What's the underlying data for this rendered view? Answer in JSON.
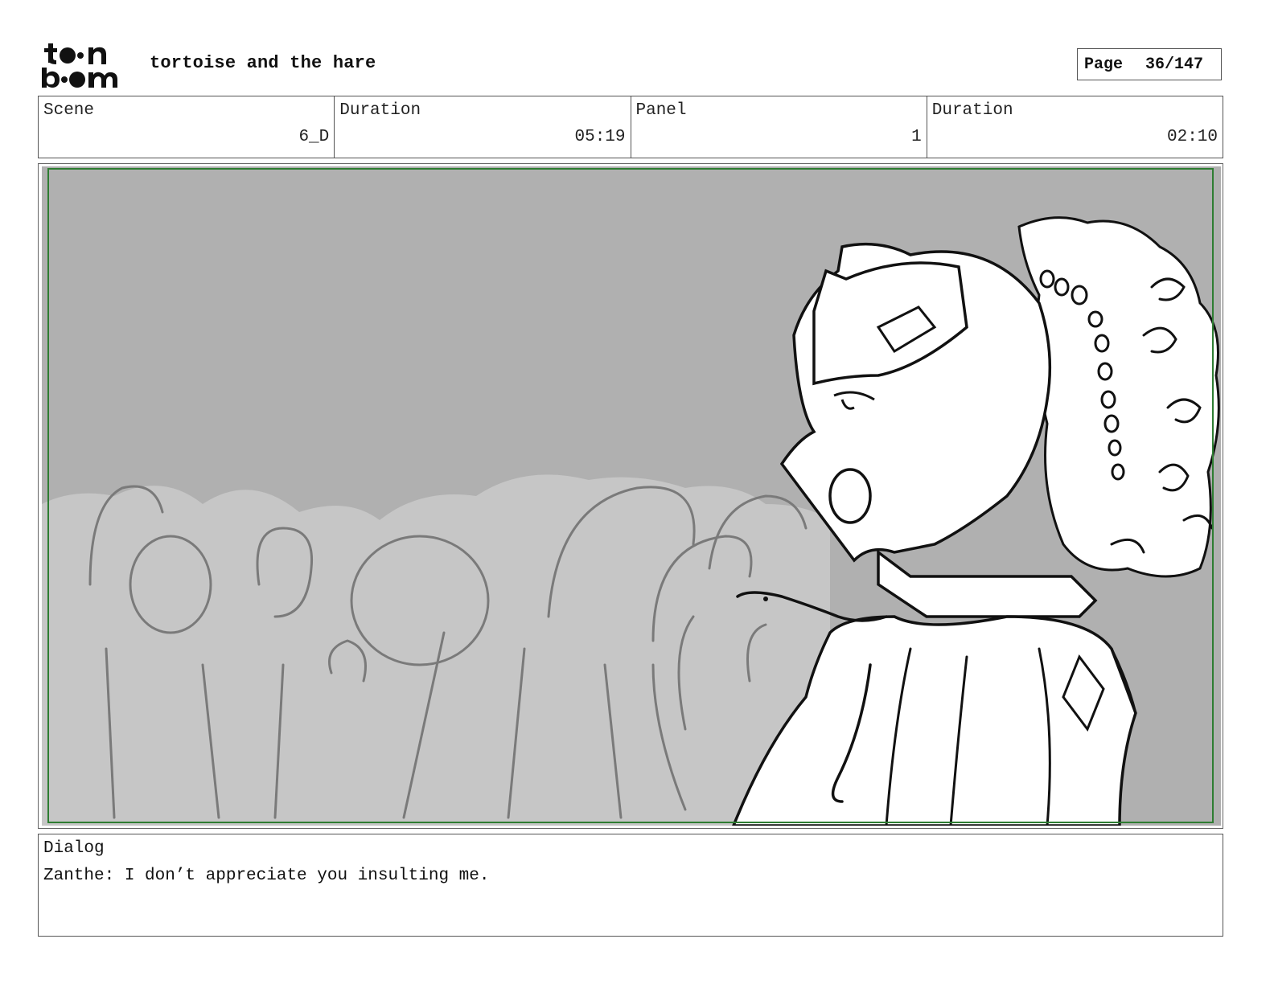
{
  "header": {
    "logo_text": "toon boom",
    "project_title": "tortoise and the hare",
    "page_label": "Page",
    "page_value": "36/147"
  },
  "info": {
    "scene_label": "Scene",
    "scene_value": "6_D",
    "scene_duration_label": "Duration",
    "scene_duration_value": "05:19",
    "panel_label": "Panel",
    "panel_value": "1",
    "panel_duration_label": "Duration",
    "panel_duration_value": "02:10"
  },
  "dialog": {
    "label": "Dialog",
    "text": "Zanthe: I don’t appreciate you insulting me."
  },
  "colors": {
    "safe_frame": "#2e7d32",
    "panel_bg": "#b0b0b0",
    "crowd": "#c6c6c6"
  }
}
